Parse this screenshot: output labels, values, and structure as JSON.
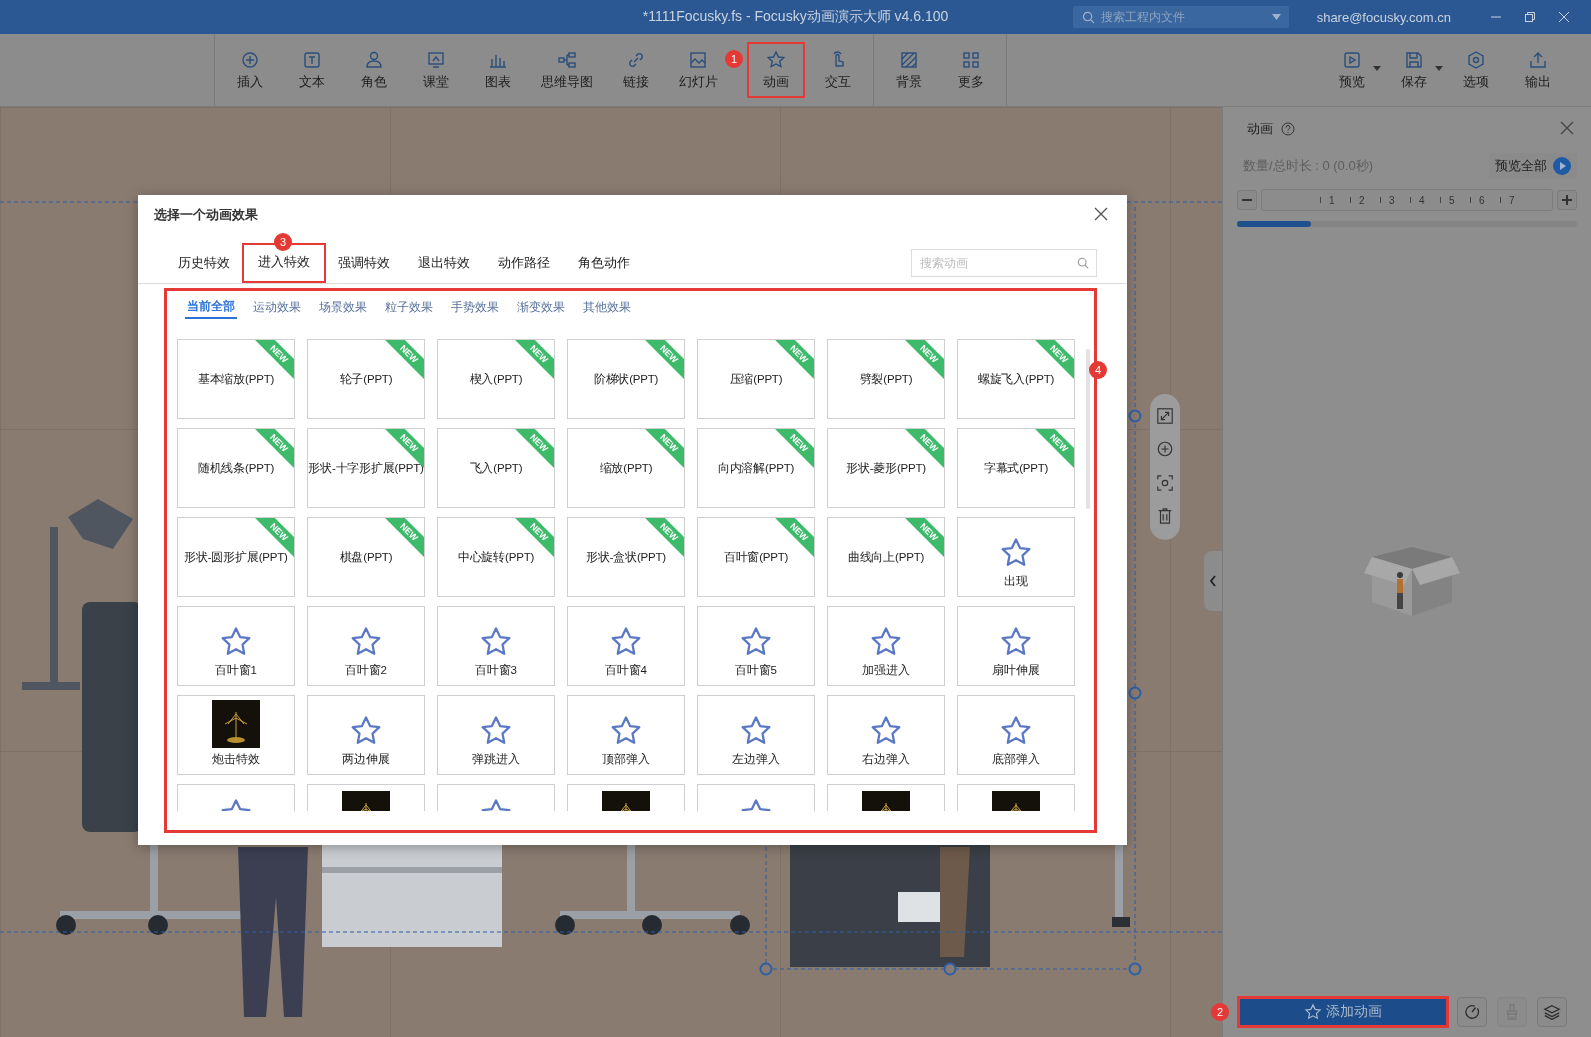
{
  "window": {
    "title": "*1111Focusky.fs - Focusky动画演示大师  v4.6.100",
    "search": {
      "placeholder": "搜索工程内文件"
    },
    "account": "share@focusky.com.cn"
  },
  "toolbar": {
    "left": [
      {
        "label": "插入"
      },
      {
        "label": "文本"
      },
      {
        "label": "角色"
      },
      {
        "label": "课堂"
      },
      {
        "label": "图表"
      },
      {
        "label": "思维导图"
      },
      {
        "label": "链接"
      },
      {
        "label": "幻灯片"
      },
      {
        "label": "动画",
        "marker": "1"
      },
      {
        "label": "交互"
      }
    ],
    "middle": [
      {
        "label": "背景"
      },
      {
        "label": "更多"
      }
    ],
    "right": [
      {
        "label": "预览",
        "dropdown": true
      },
      {
        "label": "保存",
        "dropdown": true
      },
      {
        "label": "选项",
        "dropdown": false
      },
      {
        "label": "输出",
        "dropdown": false
      }
    ]
  },
  "dialog": {
    "title": "选择一个动画效果",
    "tabs": [
      {
        "label": "历史特效",
        "selected": false
      },
      {
        "label": "进入特效",
        "selected": true,
        "marker": "3"
      },
      {
        "label": "强调特效",
        "selected": false
      },
      {
        "label": "退出特效",
        "selected": false
      },
      {
        "label": "动作路径",
        "selected": false
      },
      {
        "label": "角色动作",
        "selected": false
      }
    ],
    "search": {
      "placeholder": "搜索动画"
    },
    "subtabs": [
      {
        "label": "当前全部",
        "selected": true
      },
      {
        "label": "运动效果",
        "selected": false
      },
      {
        "label": "场景效果",
        "selected": false
      },
      {
        "label": "粒子效果",
        "selected": false
      },
      {
        "label": "手势效果",
        "selected": false
      },
      {
        "label": "渐变效果",
        "selected": false
      },
      {
        "label": "其他效果",
        "selected": false
      }
    ],
    "grid_marker": "4",
    "effects": [
      {
        "kind": "new",
        "label": "基本缩放(PPT)",
        "badge": "NEW"
      },
      {
        "kind": "new",
        "label": "轮子(PPT)",
        "badge": "NEW"
      },
      {
        "kind": "new",
        "label": "楔入(PPT)",
        "badge": "NEW"
      },
      {
        "kind": "new",
        "label": "阶梯状(PPT)",
        "badge": "NEW"
      },
      {
        "kind": "new",
        "label": "压缩(PPT)",
        "badge": "NEW"
      },
      {
        "kind": "new",
        "label": "劈裂(PPT)",
        "badge": "NEW"
      },
      {
        "kind": "new",
        "label": "螺旋飞入(PPT)",
        "badge": "NEW"
      },
      {
        "kind": "new",
        "label": "随机线条(PPT)",
        "badge": "NEW"
      },
      {
        "kind": "new",
        "label": "形状-十字形扩展(PPT)",
        "badge": "NEW"
      },
      {
        "kind": "new",
        "label": "飞入(PPT)",
        "badge": "NEW"
      },
      {
        "kind": "new",
        "label": "缩放(PPT)",
        "badge": "NEW"
      },
      {
        "kind": "new",
        "label": "向内溶解(PPT)",
        "badge": "NEW"
      },
      {
        "kind": "new",
        "label": "形状-菱形(PPT)",
        "badge": "NEW"
      },
      {
        "kind": "new",
        "label": "字幕式(PPT)",
        "badge": "NEW"
      },
      {
        "kind": "new",
        "label": "形状-圆形扩展(PPT)",
        "badge": "NEW"
      },
      {
        "kind": "new",
        "label": "棋盘(PPT)",
        "badge": "NEW"
      },
      {
        "kind": "new",
        "label": "中心旋转(PPT)",
        "badge": "NEW"
      },
      {
        "kind": "new",
        "label": "形状-盒状(PPT)",
        "badge": "NEW"
      },
      {
        "kind": "new",
        "label": "百叶窗(PPT)",
        "badge": "NEW"
      },
      {
        "kind": "new",
        "label": "曲线向上(PPT)",
        "badge": "NEW"
      },
      {
        "kind": "star",
        "label": "出现"
      },
      {
        "kind": "star",
        "label": "百叶窗1"
      },
      {
        "kind": "star",
        "label": "百叶窗2"
      },
      {
        "kind": "star",
        "label": "百叶窗3"
      },
      {
        "kind": "star",
        "label": "百叶窗4"
      },
      {
        "kind": "star",
        "label": "百叶窗5"
      },
      {
        "kind": "star",
        "label": "加强进入"
      },
      {
        "kind": "star",
        "label": "扇叶伸展"
      },
      {
        "kind": "picture",
        "label": "炮击特效"
      },
      {
        "kind": "star",
        "label": "两边伸展"
      },
      {
        "kind": "star",
        "label": "弹跳进入"
      },
      {
        "kind": "star",
        "label": "顶部弹入"
      },
      {
        "kind": "star",
        "label": "左边弹入"
      },
      {
        "kind": "star",
        "label": "右边弹入"
      },
      {
        "kind": "star",
        "label": "底部弹入"
      }
    ],
    "cut_off_effects": [
      {
        "kind": "star"
      },
      {
        "kind": "picture"
      },
      {
        "kind": "star"
      },
      {
        "kind": "picture"
      },
      {
        "kind": "star"
      },
      {
        "kind": "picture"
      },
      {
        "kind": "picture"
      }
    ]
  },
  "panel": {
    "title": "动画",
    "summary": "数量/总时长 : 0 (0.0秒)",
    "preview_all": "预览全部",
    "ruler": [
      "1",
      "2",
      "3",
      "4",
      "5",
      "6",
      "7"
    ],
    "actions": [
      {
        "label": "添加动画",
        "marker": "2",
        "disabled": false
      }
    ],
    "tools": [
      {
        "disabled": false
      },
      {
        "disabled": true
      },
      {
        "disabled": false
      }
    ]
  }
}
